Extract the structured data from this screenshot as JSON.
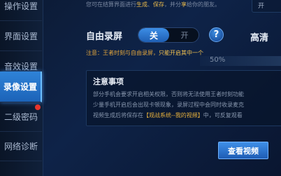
{
  "sidebar": {
    "items": [
      {
        "label": "操作设置"
      },
      {
        "label": "界面设置"
      },
      {
        "label": "音效设置"
      },
      {
        "label": "录像设置"
      },
      {
        "label": "二级密码"
      },
      {
        "label": "网络诊断"
      }
    ]
  },
  "top_hint": {
    "pre": "您可在结算界面进行",
    "generate": "生成",
    "sep": "、",
    "save": "保存",
    "mid": "，并分",
    "share": "享",
    "post": "给你的朋友。"
  },
  "top_right": {
    "label": "开"
  },
  "auto_record": {
    "label": "自由录屏",
    "on_label": "关",
    "off_label": "开",
    "help_icon": "?"
  },
  "right_label": "高清",
  "note": {
    "pre": "注意：王者时刻与自由录屏，",
    "highlight": "只能开启其中一个"
  },
  "quality_value": "50%",
  "notice": {
    "title": "注意事项",
    "line1": "部分手机会要求开启相关权限，否则将无法使用王者时刻功能",
    "line2": "少量手机开启后会出现卡顿现象，录屏过程中会同时收录麦克",
    "line3_pre": "视频生成后将保存在",
    "line3_link": "【观战系统--我的视频】",
    "line3_post": "中，可反复观看"
  },
  "view_button": {
    "label": "查看视频"
  }
}
